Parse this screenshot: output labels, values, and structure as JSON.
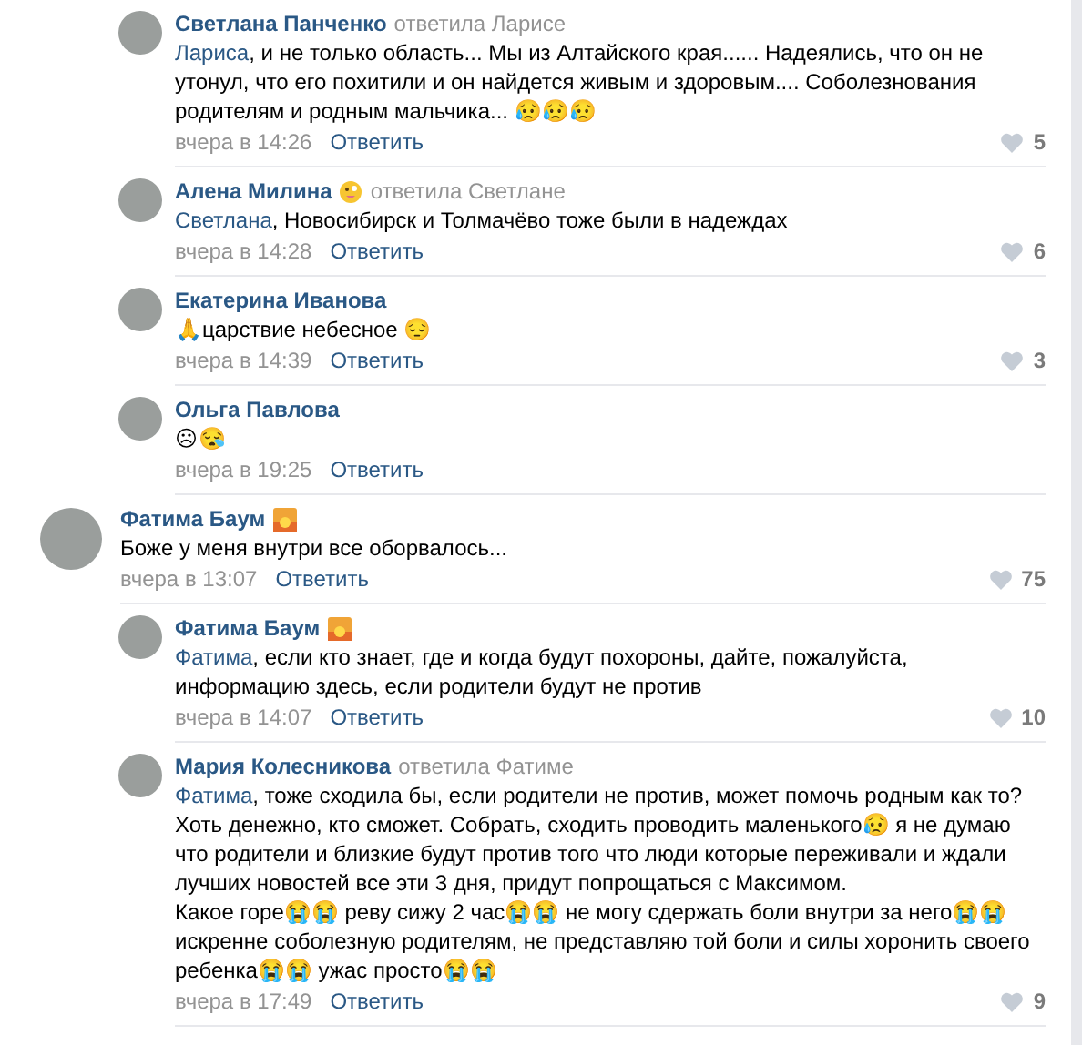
{
  "thread_replies": [
    {
      "author": "Светлана Панченко",
      "reply_to": "ответила Ларисе",
      "mention": "Лариса",
      "text": ", и не только область... Мы из Алтайского края...... Надеялись, что он не утонул, что его похитили и он найдется живым и здоровым.... Соболезнования родителям и родным мальчика... 😥😥😥",
      "time": "вчера в 14:26",
      "reply_label": "Ответить",
      "likes": "5"
    },
    {
      "author": "Алена Милина",
      "badge": {
        "kind": "face"
      },
      "reply_to": "ответила Светлане",
      "mention": "Светлана",
      "text": ", Новосибирск и Толмачёво тоже были в надеждах",
      "time": "вчера в 14:28",
      "reply_label": "Ответить",
      "likes": "6"
    },
    {
      "author": "Екатерина Иванова",
      "text": "🙏царствие небесное 😔",
      "time": "вчера в 14:39",
      "reply_label": "Ответить",
      "likes": "3"
    },
    {
      "author": "Ольга Павлова",
      "text": "☹😪",
      "time": "вчера в 19:25",
      "reply_label": "Ответить"
    }
  ],
  "comments": [
    {
      "author": "Фатима Баум",
      "badge": {
        "kind": "sunset"
      },
      "text": "Боже у меня внутри все оборвалось...",
      "time": "вчера в 13:07",
      "reply_label": "Ответить",
      "likes": "75",
      "children": [
        {
          "author": "Фатима Баум",
          "badge": {
            "kind": "sunset"
          },
          "mention": "Фатима",
          "text": ", если кто знает, где и когда будут похороны, дайте, пожалуйста, информацию здесь, если родители будут не против",
          "time": "вчера в 14:07",
          "reply_label": "Ответить",
          "likes": "10"
        },
        {
          "author": "Мария Колесникова",
          "reply_to": "ответила Фатиме",
          "mention": "Фатима",
          "text": ", тоже сходила бы, если родители не против, может помочь родным как то? Хоть денежно, кто сможет. Собрать, сходить проводить маленького😥 я не думаю что родители и близкие будут против того что люди которые переживали и ждали лучших новостей все эти 3 дня, придут попрощаться с Максимом.\nКакое горе😭😭 реву сижу 2 час😭😭 не могу сдержать боли внутри за него😭😭 искренне соболезную родителям, не представляю той боли и силы хоронить своего ребенка😭😭 ужас просто😭😭",
          "time": "вчера в 17:49",
          "reply_label": "Ответить",
          "likes": "9"
        }
      ]
    }
  ]
}
